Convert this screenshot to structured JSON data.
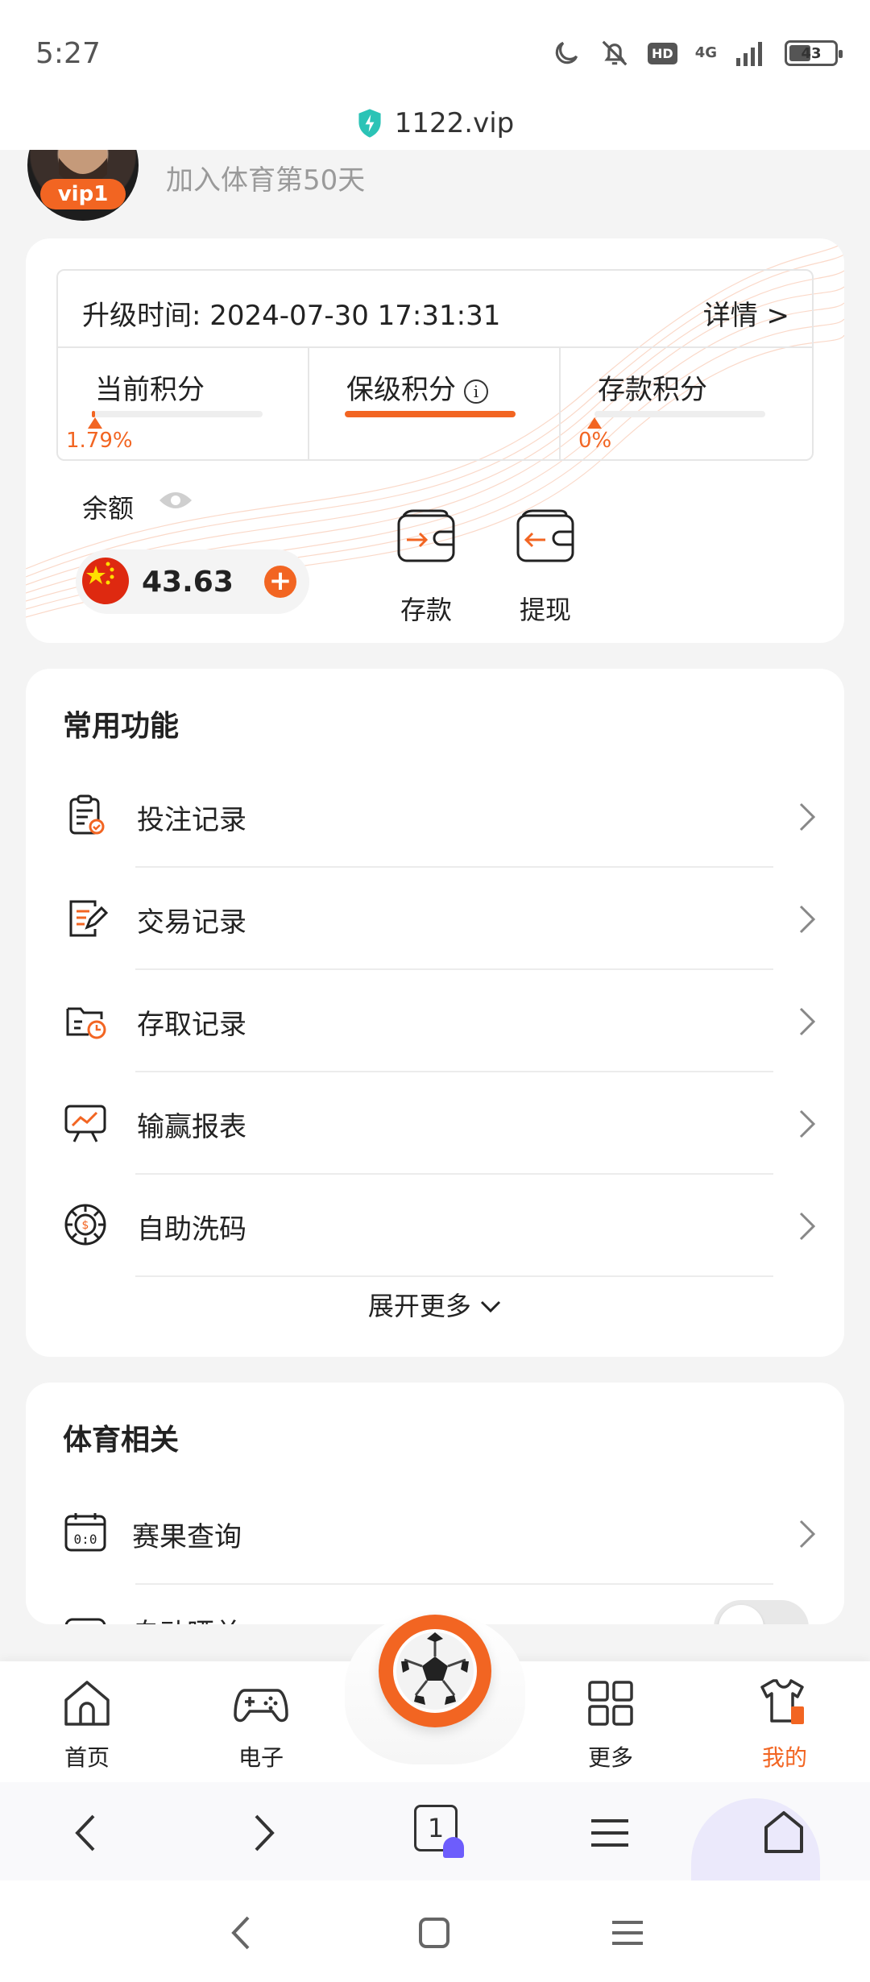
{
  "status_bar": {
    "time": "5:27",
    "hd": "HD",
    "network": "4G",
    "battery": "43"
  },
  "browser": {
    "url": "1122.vip",
    "tab_count": "1"
  },
  "profile": {
    "vip_level": "vip1",
    "join_text": "加入体育第50天"
  },
  "account": {
    "upgrade_label": "升级时间: 2024-07-30 17:31:31",
    "detail_link": "详情 >",
    "points": [
      {
        "title": "当前积分",
        "percent_label": "1.79%",
        "progress": 0.0179
      },
      {
        "title": "保级积分",
        "active": true
      },
      {
        "title": "存款积分",
        "percent_label": "0%",
        "progress": 0
      }
    ],
    "balance_label": "余额",
    "balance": "43.63",
    "deposit_label": "存款",
    "withdraw_label": "提现"
  },
  "functions": {
    "title": "常用功能",
    "items": [
      {
        "label": "投注记录",
        "icon": "clipboard-check-icon"
      },
      {
        "label": "交易记录",
        "icon": "document-edit-icon"
      },
      {
        "label": "存取记录",
        "icon": "folder-clock-icon"
      },
      {
        "label": "输赢报表",
        "icon": "chart-board-icon"
      },
      {
        "label": "自助洗码",
        "icon": "chip-icon"
      }
    ],
    "expand_label": "展开更多"
  },
  "sports": {
    "title": "体育相关",
    "items": [
      {
        "label": "赛果查询",
        "icon": "scoreboard-icon"
      },
      {
        "label": "自动晒单",
        "icon": "share-doc-icon",
        "toggle": false
      }
    ]
  },
  "bottom_nav": [
    {
      "label": "首页",
      "icon": "home-icon"
    },
    {
      "label": "电子",
      "icon": "gamepad-icon"
    },
    {
      "label": "更多",
      "icon": "grid-icon"
    },
    {
      "label": "我的",
      "icon": "shirt-icon",
      "active": true
    }
  ],
  "colors": {
    "accent": "#f26522",
    "background": "#f4f4f4",
    "card": "#ffffff"
  }
}
